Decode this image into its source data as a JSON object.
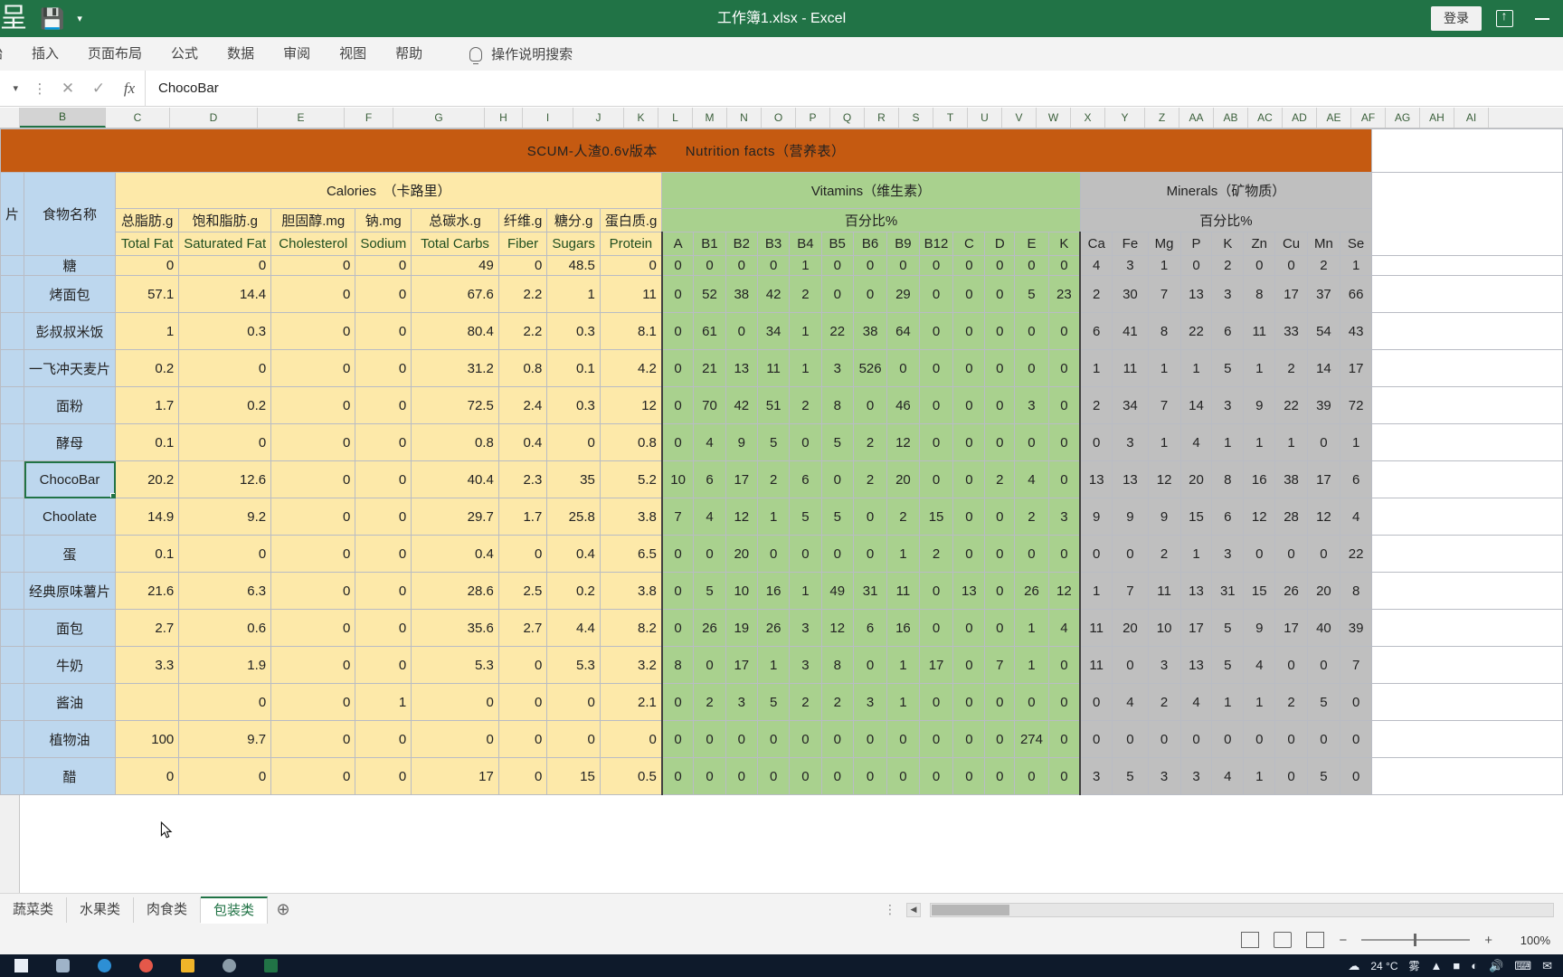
{
  "titlebar": {
    "document_title": "工作簿1.xlsx  -  Excel",
    "signin_label": "登录",
    "qat_save_icon": "save-icon",
    "qat_more_icon": "chevron-down-icon",
    "ribbon_options_icon": "ribbon-display-options-icon",
    "minimize_icon": "minimize-icon"
  },
  "ribbon_tabs": [
    {
      "label": "始"
    },
    {
      "label": "插入"
    },
    {
      "label": "页面布局"
    },
    {
      "label": "公式"
    },
    {
      "label": "数据"
    },
    {
      "label": "审阅"
    },
    {
      "label": "视图"
    },
    {
      "label": "帮助"
    }
  ],
  "tell_me": {
    "icon": "lightbulb-icon",
    "label": "操作说明搜索"
  },
  "formula_bar": {
    "name_box_value": "",
    "cancel_icon": "cancel-icon",
    "confirm_icon": "confirm-icon",
    "function_icon": "fx-icon",
    "value": "ChocoBar"
  },
  "column_headers": [
    "B",
    "C",
    "D",
    "E",
    "F",
    "G",
    "H",
    "I",
    "J",
    "K",
    "L",
    "M",
    "N",
    "O",
    "P",
    "Q",
    "R",
    "S",
    "T",
    "U",
    "V",
    "W",
    "X",
    "Y",
    "Z",
    "AA",
    "AB",
    "AC",
    "AD",
    "AE",
    "AF",
    "AG",
    "AH",
    "AI"
  ],
  "selected_column": "B",
  "sheet": {
    "banner_title": "SCUM-人渣0.6v版本　　Nutrition facts（营养表）",
    "group_headers": {
      "calories": "Calories　（卡路里）",
      "vitamins": "Vitamins（维生素）",
      "minerals": "Minerals（矿物质）"
    },
    "percent_label": "百分比%",
    "name_column_header": "食物名称",
    "left_stub_header": "片",
    "calorie_headers_cn": [
      "总脂肪.g",
      "饱和脂肪.g",
      "胆固醇.mg",
      "钠.mg",
      "总碳水.g",
      "纤维.g",
      "糖分.g",
      "蛋白质.g"
    ],
    "calorie_headers_en": [
      "Total Fat",
      "Saturated Fat",
      "Cholesterol",
      "Sodium",
      "Total Carbs",
      "Fiber",
      "Sugars",
      "Protein"
    ],
    "vitamin_headers": [
      "A",
      "B1",
      "B2",
      "B3",
      "B4",
      "B5",
      "B6",
      "B9",
      "B12",
      "C",
      "D",
      "E",
      "K"
    ],
    "mineral_headers": [
      "Ca",
      "Fe",
      "Mg",
      "P",
      "K",
      "Zn",
      "Cu",
      "Mn",
      "Se"
    ],
    "selected_cell_text": "ChocoBar",
    "clipped_top_row": {
      "name": "糖",
      "calories": [
        0,
        0,
        0,
        0,
        49,
        0,
        48.5,
        0
      ],
      "vitamins": [
        0,
        0,
        0,
        0,
        1,
        0,
        0,
        0,
        0,
        0,
        0,
        0,
        0
      ],
      "minerals": [
        4,
        3,
        1,
        0,
        2,
        0,
        0,
        2,
        1
      ]
    },
    "rows": [
      {
        "name": "烤面包",
        "calories": [
          57.1,
          14.4,
          0,
          0,
          67.6,
          2.2,
          1,
          11
        ],
        "vitamins": [
          0,
          52,
          38,
          42,
          2,
          0,
          0,
          29,
          0,
          0,
          0,
          5,
          23
        ],
        "minerals": [
          2,
          30,
          7,
          13,
          3,
          8,
          17,
          37,
          66
        ]
      },
      {
        "name": "彭叔叔米饭",
        "calories": [
          1,
          0.3,
          0,
          0,
          80.4,
          2.2,
          0.3,
          8.1
        ],
        "vitamins": [
          0,
          61,
          0,
          34,
          1,
          22,
          38,
          64,
          0,
          0,
          0,
          0,
          0
        ],
        "minerals": [
          6,
          41,
          8,
          22,
          6,
          11,
          33,
          54,
          43
        ]
      },
      {
        "name": "一飞冲天麦片",
        "calories": [
          0.2,
          0,
          0,
          0,
          31.2,
          0.8,
          0.1,
          4.2
        ],
        "vitamins": [
          0,
          21,
          13,
          11,
          1,
          3,
          526,
          0,
          0,
          0,
          0,
          0,
          0
        ],
        "minerals": [
          1,
          11,
          1,
          1,
          5,
          1,
          2,
          14,
          17
        ]
      },
      {
        "name": "面粉",
        "calories": [
          1.7,
          0.2,
          0,
          0,
          72.5,
          2.4,
          0.3,
          12
        ],
        "vitamins": [
          0,
          70,
          42,
          51,
          2,
          8,
          0,
          46,
          0,
          0,
          0,
          3,
          0
        ],
        "minerals": [
          2,
          34,
          7,
          14,
          3,
          9,
          22,
          39,
          72
        ]
      },
      {
        "name": "酵母",
        "calories": [
          0.1,
          0,
          0,
          0,
          0.8,
          0.4,
          0,
          0.8
        ],
        "vitamins": [
          0,
          4,
          9,
          5,
          0,
          5,
          2,
          12,
          0,
          0,
          0,
          0,
          0
        ],
        "minerals": [
          0,
          3,
          1,
          4,
          1,
          1,
          1,
          0,
          1
        ]
      },
      {
        "name": "ChocoBar",
        "calories": [
          20.2,
          12.6,
          0,
          0,
          40.4,
          2.3,
          35,
          5.2
        ],
        "vitamins": [
          10,
          6,
          17,
          2,
          6,
          0,
          2,
          20,
          0,
          0,
          2,
          4,
          0
        ],
        "minerals": [
          13,
          13,
          12,
          20,
          8,
          16,
          38,
          17,
          6
        ],
        "selected": true
      },
      {
        "name": "Choolate",
        "calories": [
          14.9,
          9.2,
          0,
          0,
          29.7,
          1.7,
          25.8,
          3.8
        ],
        "vitamins": [
          7,
          4,
          12,
          1,
          5,
          5,
          0,
          2,
          15,
          0,
          0,
          2,
          3
        ],
        "minerals": [
          9,
          9,
          9,
          15,
          6,
          12,
          28,
          12,
          4
        ]
      },
      {
        "name": "蛋",
        "calories": [
          0.1,
          0,
          0,
          0,
          0.4,
          0,
          0.4,
          6.5
        ],
        "vitamins": [
          0,
          0,
          20,
          0,
          0,
          0,
          0,
          1,
          2,
          0,
          0,
          0,
          0
        ],
        "minerals": [
          0,
          0,
          2,
          1,
          3,
          0,
          0,
          0,
          22
        ]
      },
      {
        "name": "经典原味薯片",
        "calories": [
          21.6,
          6.3,
          0,
          0,
          28.6,
          2.5,
          0.2,
          3.8
        ],
        "vitamins": [
          0,
          5,
          10,
          16,
          1,
          49,
          31,
          11,
          0,
          13,
          0,
          26,
          12
        ],
        "minerals": [
          1,
          7,
          11,
          13,
          31,
          15,
          26,
          20,
          8
        ]
      },
      {
        "name": "面包",
        "calories": [
          2.7,
          0.6,
          0,
          0,
          35.6,
          2.7,
          4.4,
          8.2
        ],
        "vitamins": [
          0,
          26,
          19,
          26,
          3,
          12,
          6,
          16,
          0,
          0,
          0,
          1,
          4
        ],
        "minerals": [
          11,
          20,
          10,
          17,
          5,
          9,
          17,
          40,
          39
        ]
      },
      {
        "name": "牛奶",
        "calories": [
          3.3,
          1.9,
          0,
          0,
          5.3,
          0,
          5.3,
          3.2
        ],
        "vitamins": [
          8,
          0,
          17,
          1,
          3,
          8,
          0,
          1,
          17,
          0,
          7,
          1,
          0
        ],
        "minerals": [
          11,
          0,
          3,
          13,
          5,
          4,
          0,
          0,
          7
        ]
      },
      {
        "name": "酱油",
        "calories": [
          "",
          0,
          0,
          1,
          0,
          0,
          0,
          2.1
        ],
        "vitamins": [
          0,
          2,
          3,
          5,
          2,
          2,
          3,
          1,
          0,
          0,
          0,
          0,
          0
        ],
        "minerals": [
          0,
          4,
          2,
          4,
          1,
          1,
          2,
          5,
          0
        ]
      },
      {
        "name": "植物油",
        "calories": [
          100,
          9.7,
          0,
          0,
          0,
          0,
          0,
          0
        ],
        "vitamins": [
          0,
          0,
          0,
          0,
          0,
          0,
          0,
          0,
          0,
          0,
          0,
          274,
          0
        ],
        "minerals": [
          0,
          0,
          0,
          0,
          0,
          0,
          0,
          0,
          0
        ]
      },
      {
        "name": "醋",
        "calories": [
          0,
          0,
          0,
          0,
          17,
          0,
          15,
          0.5
        ],
        "vitamins": [
          0,
          0,
          0,
          0,
          0,
          0,
          0,
          0,
          0,
          0,
          0,
          0,
          0
        ],
        "minerals": [
          3,
          5,
          3,
          3,
          4,
          1,
          0,
          5,
          0
        ]
      }
    ]
  },
  "sheet_tabs": [
    {
      "label": "蔬菜类",
      "active": false
    },
    {
      "label": "水果类",
      "active": false
    },
    {
      "label": "肉食类",
      "active": false
    },
    {
      "label": "包装类",
      "active": true
    }
  ],
  "add_sheet_icon": "plus-circle-icon",
  "status_bar": {
    "normal_view_icon": "normal-view-icon",
    "page_layout_icon": "page-layout-icon",
    "page_break_icon": "page-break-preview-icon",
    "zoom_out_icon": "zoom-out-icon",
    "zoom_in_icon": "zoom-in-icon",
    "zoom_level": "100%"
  },
  "taskbar": {
    "start_icon": "windows-start-icon",
    "items": [
      "camera-icon",
      "browser-icon",
      "chrome-icon",
      "file-explorer-icon",
      "media-icon",
      "excel-icon"
    ],
    "weather_icon": "cloud-icon",
    "temperature": "24 °C",
    "weather_text": "雾",
    "tray_icons": [
      "up-chevron-icon",
      "battery-icon",
      "network-icon",
      "volume-icon",
      "keyboard-icon",
      "notification-icon"
    ]
  },
  "colors": {
    "brand_green": "#217346",
    "banner_orange": "#c55a11",
    "calories_yellow": "#fde9a9",
    "vitamins_green": "#a9d18e",
    "minerals_gray": "#bfbfbf",
    "name_blue": "#bdd7ee"
  }
}
